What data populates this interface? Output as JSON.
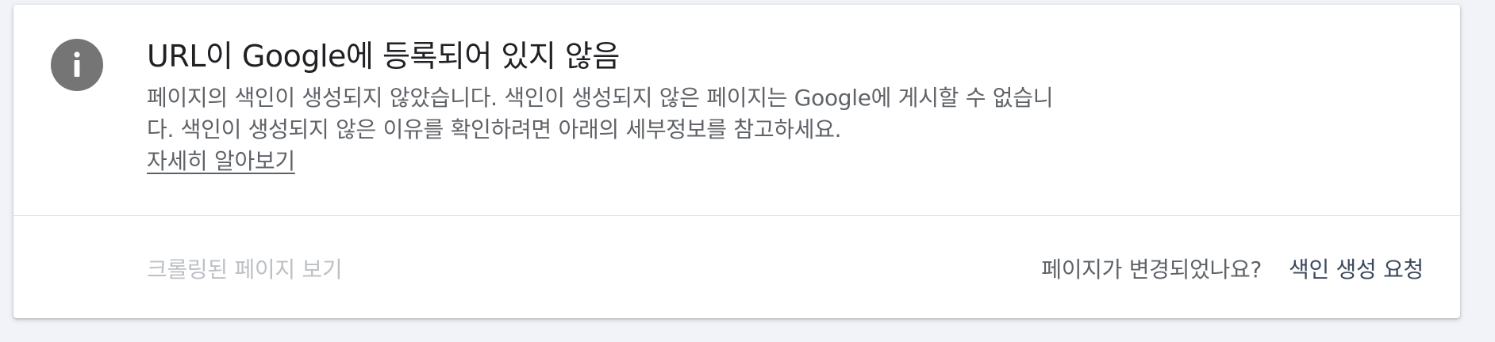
{
  "status_card": {
    "icon": "info-icon",
    "title": "URL이 Google에 등록되어 있지 않음",
    "description": "페이지의 색인이 생성되지 않았습니다. 색인이 생성되지 않은 페이지는 Google에 게시할 수 없습니다. 색인이 생성되지 않은 이유를 확인하려면 아래의 세부정보를 참고하세요.",
    "learn_more": "자세히 알아보기"
  },
  "footer": {
    "view_crawled_page": "크롤링된 페이지 보기",
    "page_changed_question": "페이지가 변경되었나요?",
    "request_indexing": "색인 생성 요청"
  },
  "colors": {
    "background": "#f1f3f8",
    "card": "#ffffff",
    "icon": "#757575",
    "title": "#202124",
    "body_text": "#5f6368",
    "disabled_text": "#bdc1c6",
    "action_text": "#3c4a5d"
  }
}
